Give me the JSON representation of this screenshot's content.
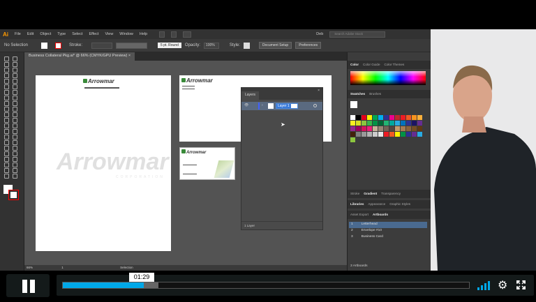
{
  "illustrator": {
    "logo": "Ai",
    "menu": [
      "File",
      "Edit",
      "Object",
      "Type",
      "Select",
      "Effect",
      "View",
      "Window",
      "Help"
    ],
    "user": "Deb",
    "search_placeholder": "Search Adobe Stock",
    "control": {
      "selection": "No Selection",
      "stroke_label": "Stroke:",
      "brush": "5 pt. Round",
      "opacity_label": "Opacity:",
      "opacity": "100%",
      "style_label": "Style:",
      "document_setup": "Document Setup",
      "preferences": "Preferences"
    },
    "doc_tab": "Business Collateral Pkg.ai* @ 66% (CMYK/GPU Preview)",
    "artboards_content": {
      "logo": "Arrowmar",
      "corp": "CORPORATION"
    },
    "layers_panel": {
      "tab": "Layers",
      "layer_name": "Layer 1",
      "footer": "1 Layer"
    },
    "status": {
      "zoom": "66%",
      "artboard": "1",
      "tool": "Selection"
    },
    "right_panel": {
      "color_tabs": [
        "Color",
        "Color Guide",
        "Color Themes"
      ],
      "swatch_tabs": [
        "Swatches",
        "Brushes"
      ],
      "stroke_tabs": [
        "Stroke",
        "Gradient",
        "Transparency"
      ],
      "lib_tabs": [
        "Libraries",
        "Appearance",
        "Graphic Styles"
      ],
      "ab_tabs": [
        "Asset Export",
        "Artboards"
      ],
      "artboards": [
        {
          "num": "1",
          "name": "Letterhead"
        },
        {
          "num": "2",
          "name": "Envelope #10"
        },
        {
          "num": "3",
          "name": "Business Card"
        }
      ],
      "footer": "3 Artboards",
      "swatch_colors": [
        "#ffffff",
        "#000000",
        "#e3001b",
        "#fff200",
        "#00a651",
        "#00aeef",
        "#2e3192",
        "#ec008c",
        "#c1272d",
        "#ed1c24",
        "#f15a24",
        "#f7931e",
        "#fbb03b",
        "#fcee21",
        "#d9e021",
        "#8cc63f",
        "#39b54a",
        "#009245",
        "#006837",
        "#22b573",
        "#00a99d",
        "#29abe2",
        "#0071bc",
        "#2e3192",
        "#1b1464",
        "#662d91",
        "#93278f",
        "#9e005d",
        "#d4145a",
        "#ed1e79",
        "#c7b299",
        "#998675",
        "#736357",
        "#534741",
        "#c69c6d",
        "#a67c52",
        "#8c6239",
        "#754c24",
        "#603813",
        "#42210b",
        "#808080",
        "#999999",
        "#b3b3b3",
        "#cccccc",
        "#e6e6e6",
        "#ed1c24",
        "#f15a24",
        "#fff200",
        "#009245",
        "#2e3192",
        "#662d91",
        "#29abe2",
        "#8cc63f"
      ]
    }
  },
  "player": {
    "time_tooltip": "01:29",
    "played_fraction": 0.2,
    "buffered_fraction": 0.235,
    "accent": "#00a8e8"
  }
}
